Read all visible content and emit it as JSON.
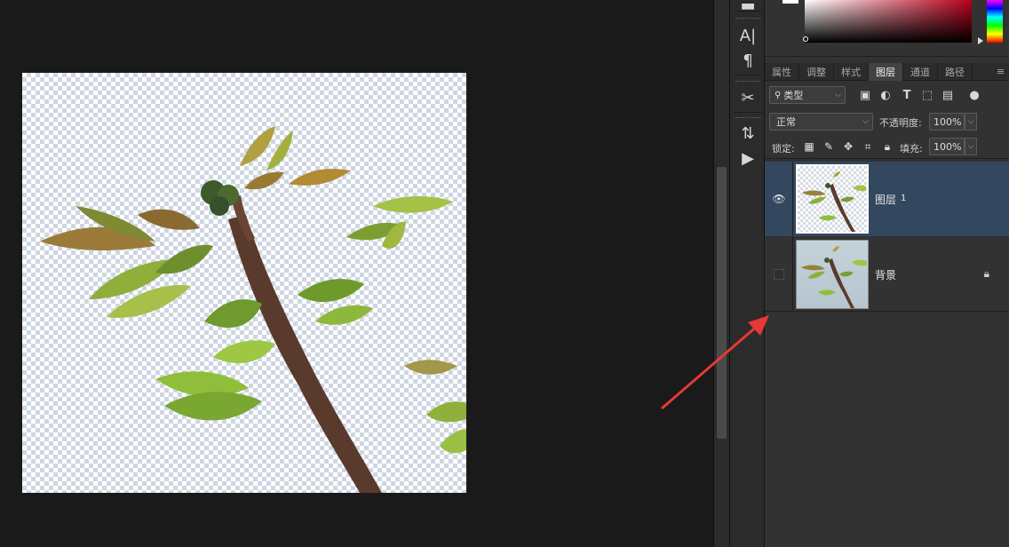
{
  "tools": {
    "items": [
      {
        "name": "character-panel-icon",
        "glyph": "A|"
      },
      {
        "name": "paragraph-panel-icon",
        "glyph": "¶"
      },
      {
        "name": "tool-presets-icon",
        "glyph": "✂"
      },
      {
        "name": "history-panel-icon",
        "glyph": "⇅"
      },
      {
        "name": "actions-play-icon",
        "glyph": "▶"
      }
    ]
  },
  "panel_tabs": [
    {
      "label": "属性",
      "active": false
    },
    {
      "label": "调整",
      "active": false
    },
    {
      "label": "样式",
      "active": false
    },
    {
      "label": "图层",
      "active": true
    },
    {
      "label": "通道",
      "active": false
    },
    {
      "label": "路径",
      "active": false
    }
  ],
  "layers_panel": {
    "filter_label": "类型",
    "blend_mode": "正常",
    "opacity_label": "不透明度:",
    "opacity_value": "100%",
    "lock_label": "锁定:",
    "fill_label": "填充:",
    "fill_value": "100%"
  },
  "layers": [
    {
      "name": "图层",
      "number": "1",
      "selected": true,
      "visible": true,
      "locked": false
    },
    {
      "name": "背景",
      "number": "",
      "selected": false,
      "visible": false,
      "locked": true
    }
  ],
  "colors": {
    "panel_bg": "#323232",
    "selected_layer": "#33475f",
    "arrow": "#e53935"
  }
}
